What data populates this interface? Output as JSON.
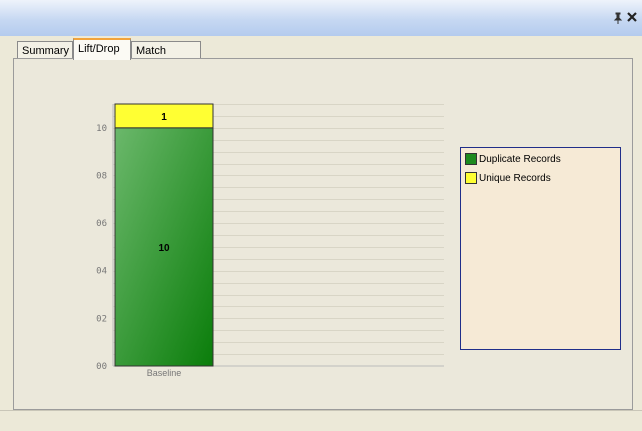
{
  "window": {
    "pin_glyph": "ᴘ",
    "close_glyph": "✕",
    "pin_icon": "pin-icon",
    "close_icon": "close-icon"
  },
  "tabs": [
    {
      "label": "Summary",
      "active": false
    },
    {
      "label": "Lift/Drop",
      "active": true
    },
    {
      "label": "Match Rules",
      "active": false
    }
  ],
  "chart_data": {
    "type": "bar",
    "stacked": true,
    "categories": [
      "Baseline"
    ],
    "series": [
      {
        "name": "Duplicate Records",
        "values": [
          10
        ],
        "color": "#1e8a1e"
      },
      {
        "name": "Unique Records",
        "values": [
          1
        ],
        "color": "#ffff33"
      }
    ],
    "data_labels": [
      "10",
      "1"
    ],
    "yticks": [
      "00",
      "02",
      "04",
      "06",
      "08",
      "10"
    ],
    "ylim": [
      0,
      11
    ],
    "grid": true,
    "legend_position": "right",
    "title": "",
    "xlabel": "",
    "ylabel": ""
  },
  "legend": {
    "items": [
      {
        "label": "Duplicate Records",
        "color": "#1e8a1e"
      },
      {
        "label": "Unique Records",
        "color": "#ffff33"
      }
    ]
  }
}
